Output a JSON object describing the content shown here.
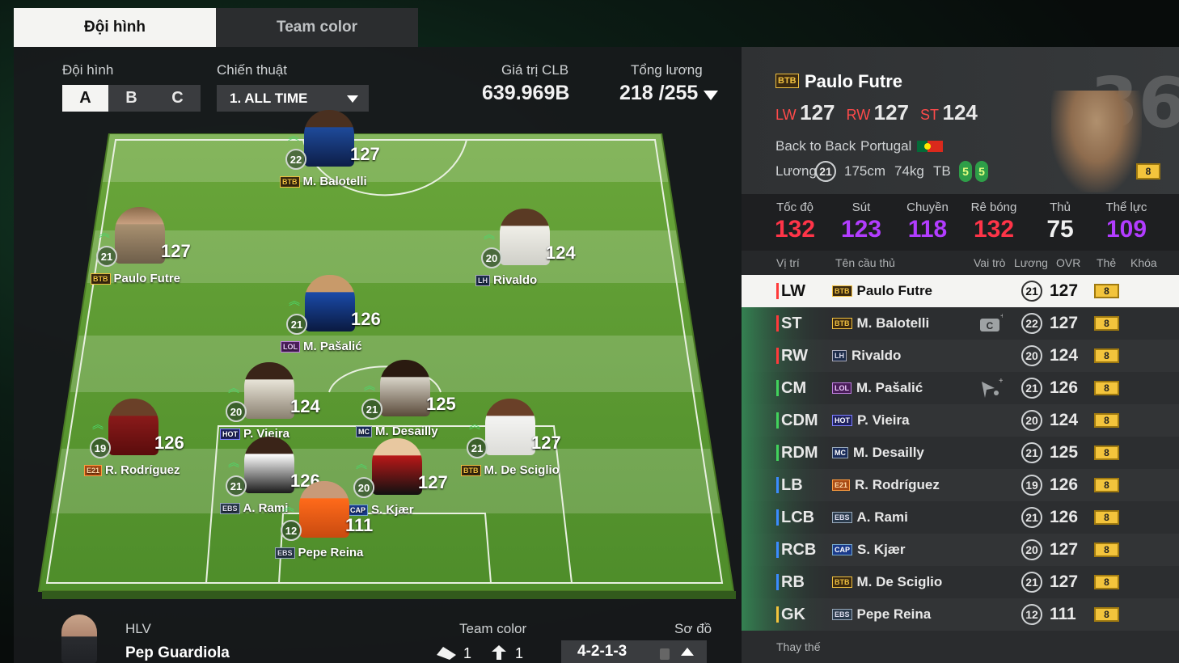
{
  "tabs": {
    "active": "Đội hình",
    "inactive": "Team color"
  },
  "squad": {
    "label": "Đội hình",
    "slots": [
      "A",
      "B",
      "C"
    ],
    "tactic_label": "Chiến thuật",
    "tactic_value": "1. ALL TIME",
    "club_value_label": "Giá trị CLB",
    "club_value": "639.969B",
    "salary_label": "Tổng lương",
    "salary_value": "218 /255"
  },
  "pitch_players": [
    {
      "pos": "ST",
      "name": "M. Balotelli",
      "badge": "BTB",
      "rating": "127",
      "level": "22"
    },
    {
      "pos": "LW",
      "name": "Paulo Futre",
      "badge": "BTB",
      "rating": "127",
      "level": "21"
    },
    {
      "pos": "RW",
      "name": "Rivaldo",
      "badge": "LH",
      "rating": "124",
      "level": "20"
    },
    {
      "pos": "CM",
      "name": "M. Pašalić",
      "badge": "LOL",
      "rating": "126",
      "level": "21"
    },
    {
      "pos": "CDM",
      "name": "P. Vieira",
      "badge": "HOT",
      "rating": "124",
      "level": "20"
    },
    {
      "pos": "RDM",
      "name": "M. Desailly",
      "badge": "MC",
      "rating": "125",
      "level": "21"
    },
    {
      "pos": "LB",
      "name": "R. Rodríguez",
      "badge": "E21",
      "rating": "126",
      "level": "19"
    },
    {
      "pos": "RB",
      "name": "M. De Sciglio",
      "badge": "BTB",
      "rating": "127",
      "level": "21"
    },
    {
      "pos": "LCB",
      "name": "A. Rami",
      "badge": "EBS",
      "rating": "126",
      "level": "21"
    },
    {
      "pos": "RCB",
      "name": "S. Kjær",
      "badge": "CAP",
      "rating": "127",
      "level": "20"
    },
    {
      "pos": "GK",
      "name": "Pepe Reina",
      "badge": "EBS",
      "rating": "111",
      "level": "12"
    }
  ],
  "coach": {
    "label": "HLV",
    "name": "Pep Guardiola"
  },
  "team_color": {
    "label": "Team color",
    "count_a": "1",
    "count_b": "1"
  },
  "formation": {
    "label": "Sơ đồ",
    "value": "4-2-1-3"
  },
  "selected_player": {
    "badge": "BTB",
    "name": "Paulo Futre",
    "positions": [
      {
        "pos": "LW",
        "val": "127"
      },
      {
        "pos": "RW",
        "val": "127"
      },
      {
        "pos": "ST",
        "val": "124"
      }
    ],
    "trait": "Back to Back",
    "nation": "Portugal",
    "salary_label": "Lương",
    "salary": "21",
    "height": "175cm",
    "weight": "74kg",
    "body": "TB",
    "skill1": "5",
    "skill2": "5",
    "number": "36",
    "grade": "8",
    "accent_colors": {
      "pos": "#ff4a4a",
      "speed": "#ff3b4e",
      "shoot": "#b03bff"
    }
  },
  "stats": [
    {
      "label": "Tốc độ",
      "value": "132",
      "color": "#ff3448"
    },
    {
      "label": "Sút",
      "value": "123",
      "color": "#b23cff"
    },
    {
      "label": "Chuyền",
      "value": "118",
      "color": "#b23cff"
    },
    {
      "label": "Rê bóng",
      "value": "132",
      "color": "#ff3448"
    },
    {
      "label": "Thủ",
      "value": "75",
      "color": "#f0f0f0"
    },
    {
      "label": "Thể lực",
      "value": "109",
      "color": "#b23cff"
    }
  ],
  "table_headers": {
    "position": "Vị trí",
    "name": "Tên cầu thủ",
    "role": "Vai trò",
    "salary": "Lương",
    "ovr": "OVR",
    "card": "Thẻ",
    "lock": "Khóa"
  },
  "roster": [
    {
      "pos": "LW",
      "badge": "BTB",
      "name": "Paulo Futre",
      "salary": "21",
      "ovr": "127",
      "grade": "8",
      "bar": "#ff3a3a",
      "role": ""
    },
    {
      "pos": "ST",
      "badge": "BTB",
      "name": "M. Balotelli",
      "salary": "22",
      "ovr": "127",
      "grade": "8",
      "bar": "#ff3a3a",
      "role": "captain-icon"
    },
    {
      "pos": "RW",
      "badge": "LH",
      "name": "Rivaldo",
      "salary": "20",
      "ovr": "124",
      "grade": "8",
      "bar": "#ff3a3a",
      "role": ""
    },
    {
      "pos": "CM",
      "badge": "LOL",
      "name": "M. Pašalić",
      "salary": "21",
      "ovr": "126",
      "grade": "8",
      "bar": "#42d35c",
      "role": "set-piece-icon"
    },
    {
      "pos": "CDM",
      "badge": "HOT",
      "name": "P. Vieira",
      "salary": "20",
      "ovr": "124",
      "grade": "8",
      "bar": "#42d35c",
      "role": ""
    },
    {
      "pos": "RDM",
      "badge": "MC",
      "name": "M. Desailly",
      "salary": "21",
      "ovr": "125",
      "grade": "8",
      "bar": "#42d35c",
      "role": ""
    },
    {
      "pos": "LB",
      "badge": "E21",
      "name": "R. Rodríguez",
      "salary": "19",
      "ovr": "126",
      "grade": "8",
      "bar": "#3a8cff",
      "role": ""
    },
    {
      "pos": "LCB",
      "badge": "EBS",
      "name": "A. Rami",
      "salary": "21",
      "ovr": "126",
      "grade": "8",
      "bar": "#3a8cff",
      "role": ""
    },
    {
      "pos": "RCB",
      "badge": "CAP",
      "name": "S. Kjær",
      "salary": "20",
      "ovr": "127",
      "grade": "8",
      "bar": "#3a8cff",
      "role": ""
    },
    {
      "pos": "RB",
      "badge": "BTB",
      "name": "M. De Sciglio",
      "salary": "21",
      "ovr": "127",
      "grade": "8",
      "bar": "#3a8cff",
      "role": ""
    },
    {
      "pos": "GK",
      "badge": "EBS",
      "name": "Pepe Reina",
      "salary": "12",
      "ovr": "111",
      "grade": "8",
      "bar": "#f3c43c",
      "role": ""
    }
  ],
  "substitutes_label": "Thay thế"
}
